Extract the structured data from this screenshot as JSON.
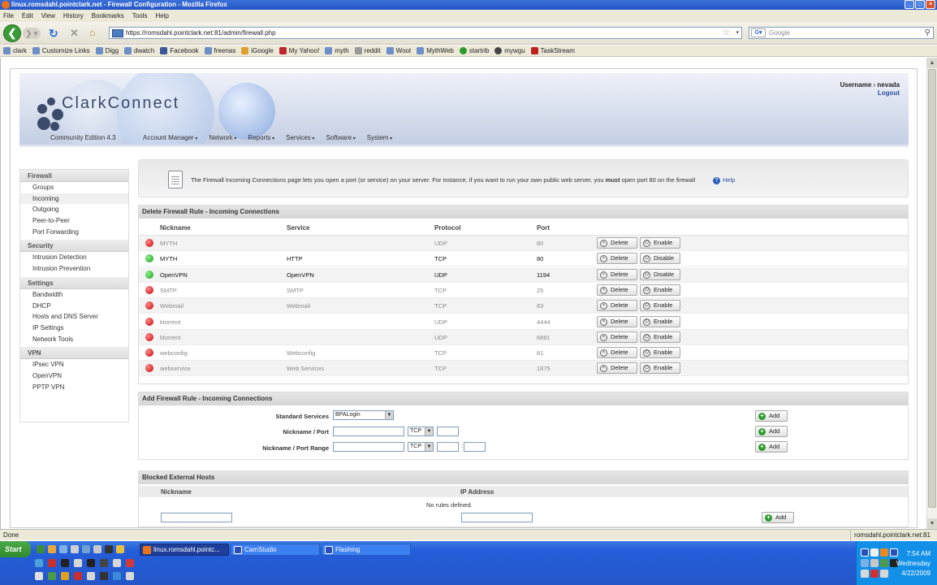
{
  "window": {
    "title": "linux.romsdahl.pointclark.net - Firewall Configuration - Mozilla Firefox"
  },
  "menu": [
    "File",
    "Edit",
    "View",
    "History",
    "Bookmarks",
    "Tools",
    "Help"
  ],
  "url": "https://romsdahl.pointclark.net:81/admin/firewall.php",
  "search_placeholder": "Google",
  "bookmarks": [
    "clark",
    "Customize Links",
    "Digg",
    "dwatch",
    "Facebook",
    "freenas",
    "iGoogle",
    "My Yahoo!",
    "myth",
    "reddit",
    "Woot",
    "MythWeb",
    "startrib",
    "mywgu",
    "TaskStream"
  ],
  "header": {
    "logo": "ClarkConnect",
    "edition": "Community Edition 4.3",
    "username_label": "Username",
    "username_sep": "›",
    "username": "nevada",
    "logout": "Logout"
  },
  "topnav": [
    "Account Manager",
    "Network",
    "Reports",
    "Services",
    "Software",
    "System"
  ],
  "sidebar": [
    {
      "head": "Firewall",
      "items": [
        "Groups",
        "Incoming",
        "Outgoing",
        "Peer-to-Peer",
        "Port Forwarding"
      ]
    },
    {
      "head": "Security",
      "items": [
        "Intrusion Detection",
        "Intrusion Prevention"
      ]
    },
    {
      "head": "Settings",
      "items": [
        "Bandwidth",
        "DHCP",
        "Hosts and DNS Server",
        "IP Settings",
        "Network Tools"
      ]
    },
    {
      "head": "VPN",
      "items": [
        "IPsec VPN",
        "OpenVPN",
        "PPTP VPN"
      ]
    }
  ],
  "info": {
    "text_before": "The Firewall Incoming Connections page lets you open a port (or service) on your server. For instance, if you want to run your own public web server, you ",
    "text_bold": "must",
    "text_after": " open port 80 on the firewall",
    "help": "Help"
  },
  "delete_panel": {
    "title": "Delete Firewall Rule - Incoming Connections",
    "headers": {
      "nickname": "Nickname",
      "service": "Service",
      "protocol": "Protocol",
      "port": "Port"
    },
    "delete_label": "Delete",
    "rows": [
      {
        "nickname": "MYTH",
        "service": "",
        "protocol": "UDP",
        "port": "80",
        "status": "off",
        "action": "Enable"
      },
      {
        "nickname": "MYTH",
        "service": "HTTP",
        "protocol": "TCP",
        "port": "80",
        "status": "on",
        "action": "Disable"
      },
      {
        "nickname": "OpenVPN",
        "service": "OpenVPN",
        "protocol": "UDP",
        "port": "1194",
        "status": "on",
        "action": "Disable"
      },
      {
        "nickname": "SMTP",
        "service": "SMTP",
        "protocol": "TCP",
        "port": "25",
        "status": "off",
        "action": "Enable"
      },
      {
        "nickname": "Webmail",
        "service": "Webmail",
        "protocol": "TCP",
        "port": "83",
        "status": "off",
        "action": "Enable"
      },
      {
        "nickname": "ktorrent",
        "service": "",
        "protocol": "UDP",
        "port": "4444",
        "status": "off",
        "action": "Enable"
      },
      {
        "nickname": "ktorrent",
        "service": "",
        "protocol": "UDP",
        "port": "6881",
        "status": "off",
        "action": "Enable"
      },
      {
        "nickname": "webconfig",
        "service": "Webconfig",
        "protocol": "TCP",
        "port": "81",
        "status": "off",
        "action": "Enable"
      },
      {
        "nickname": "webservice",
        "service": "Web Services",
        "protocol": "TCP",
        "port": "1875",
        "status": "off",
        "action": "Enable"
      }
    ]
  },
  "add_panel": {
    "title": "Add Firewall Rule - Incoming Connections",
    "standard_services_label": "Standard Services",
    "standard_services_value": "BPALogin",
    "nickname_port_label": "Nickname / Port",
    "nickname_port_range_label": "Nickname / Port Range",
    "protocol_value": "TCP",
    "range_sep": ":",
    "add_label": "Add"
  },
  "blocked_panel": {
    "title": "Blocked External Hosts",
    "nickname_header": "Nickname",
    "ip_header": "IP Address",
    "empty": "No rules defined.",
    "add_label": "Add"
  },
  "status": {
    "left": "Done",
    "right": "romsdahl.pointclark.net:81"
  },
  "taskbar": {
    "start": "Start",
    "tasks": [
      "linux.romsdahl.pointc...",
      "CamStudio",
      "Flashing"
    ],
    "time": "7:54 AM",
    "day": "Wednesday",
    "date": "4/22/2009"
  },
  "colors": {
    "accent": "#2a4f9c",
    "enabled": "#159a15",
    "disabled": "#c80000"
  }
}
